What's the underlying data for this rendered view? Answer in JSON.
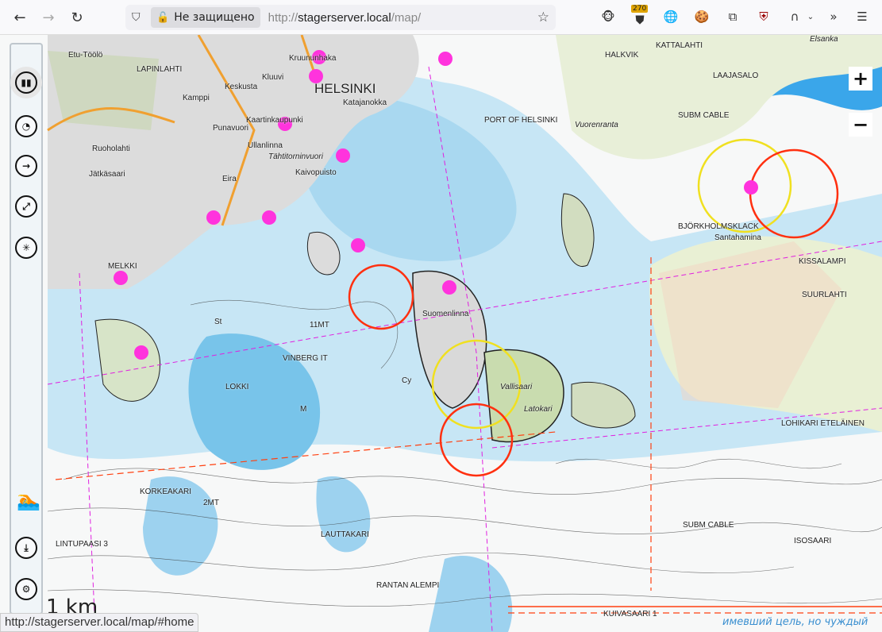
{
  "browser": {
    "nav": {
      "back": "←",
      "forward": "→",
      "reload": "↻"
    },
    "security_label": "Не защищено",
    "url_prefix": "http://",
    "url_host": "stagerserver.local",
    "url_path": "/map/",
    "extension_badge": "270",
    "status_url": "http://stagerserver.local/map/#home"
  },
  "sidebar": {
    "items": [
      {
        "icon": "map-icon",
        "glyph": "▮▮"
      },
      {
        "icon": "dashboard-icon",
        "glyph": "◔"
      },
      {
        "icon": "route-icon",
        "glyph": "→"
      },
      {
        "icon": "track-icon",
        "glyph": "⤢"
      },
      {
        "icon": "compass-rose-icon",
        "glyph": "✳"
      },
      {
        "icon": "man-overboard-icon",
        "glyph": "🏊"
      },
      {
        "icon": "download-icon",
        "glyph": "⤓"
      },
      {
        "icon": "settings-icon",
        "glyph": "⚙"
      }
    ]
  },
  "zoom": {
    "in": "+",
    "out": "−"
  },
  "scale_label": "1 km",
  "motto": "имевший цель, но чуждый",
  "map_labels": [
    {
      "t": "HELSINKI",
      "c": "big"
    },
    {
      "t": "Etu-Töölö"
    },
    {
      "t": "LAPINLAHTI"
    },
    {
      "t": "Kamppi"
    },
    {
      "t": "Keskusta"
    },
    {
      "t": "Kluuvi"
    },
    {
      "t": "Kruununhaka"
    },
    {
      "t": "Katajanokka"
    },
    {
      "t": "Kaartinkaupunki"
    },
    {
      "t": "Punavuori"
    },
    {
      "t": "Ullanlinna"
    },
    {
      "t": "Tähtitorninvuori",
      "c": "it"
    },
    {
      "t": "Kaivopuisto"
    },
    {
      "t": "Eira"
    },
    {
      "t": "Jätkäsaari"
    },
    {
      "t": "Ruoholahti"
    },
    {
      "t": "PORT OF HELSINKI"
    },
    {
      "t": "Suomenlinna"
    },
    {
      "t": "Vallisaari"
    },
    {
      "t": "Santahamina"
    },
    {
      "t": "KISSALAMPI"
    },
    {
      "t": "SUURLAHTI"
    },
    {
      "t": "BJÖRKHOLMSKLACK"
    },
    {
      "t": "SUBM CABLE"
    },
    {
      "t": "SUBM CABLE"
    },
    {
      "t": "LOHIKARI ETELÄINEN"
    },
    {
      "t": "ISOSAARI"
    },
    {
      "t": "KUIVASAARI 1"
    },
    {
      "t": "RANTAN ALEMPI"
    },
    {
      "t": "LINTUPAASI 3"
    },
    {
      "t": "LOKKI"
    },
    {
      "t": "VINBERG IT"
    },
    {
      "t": "11MT"
    },
    {
      "t": "HALKVIK"
    },
    {
      "t": "KATTALAHTI"
    },
    {
      "t": "LAAJASALO"
    },
    {
      "t": "MELKKI"
    },
    {
      "t": "KORKEAKARI"
    },
    {
      "t": "LAUTTAKARI"
    },
    {
      "t": "Latokari"
    },
    {
      "t": "Vuorenranta"
    },
    {
      "t": "Elsanka"
    },
    {
      "t": "2MT"
    },
    {
      "t": "Cy"
    },
    {
      "t": "St"
    },
    {
      "t": "M"
    }
  ]
}
